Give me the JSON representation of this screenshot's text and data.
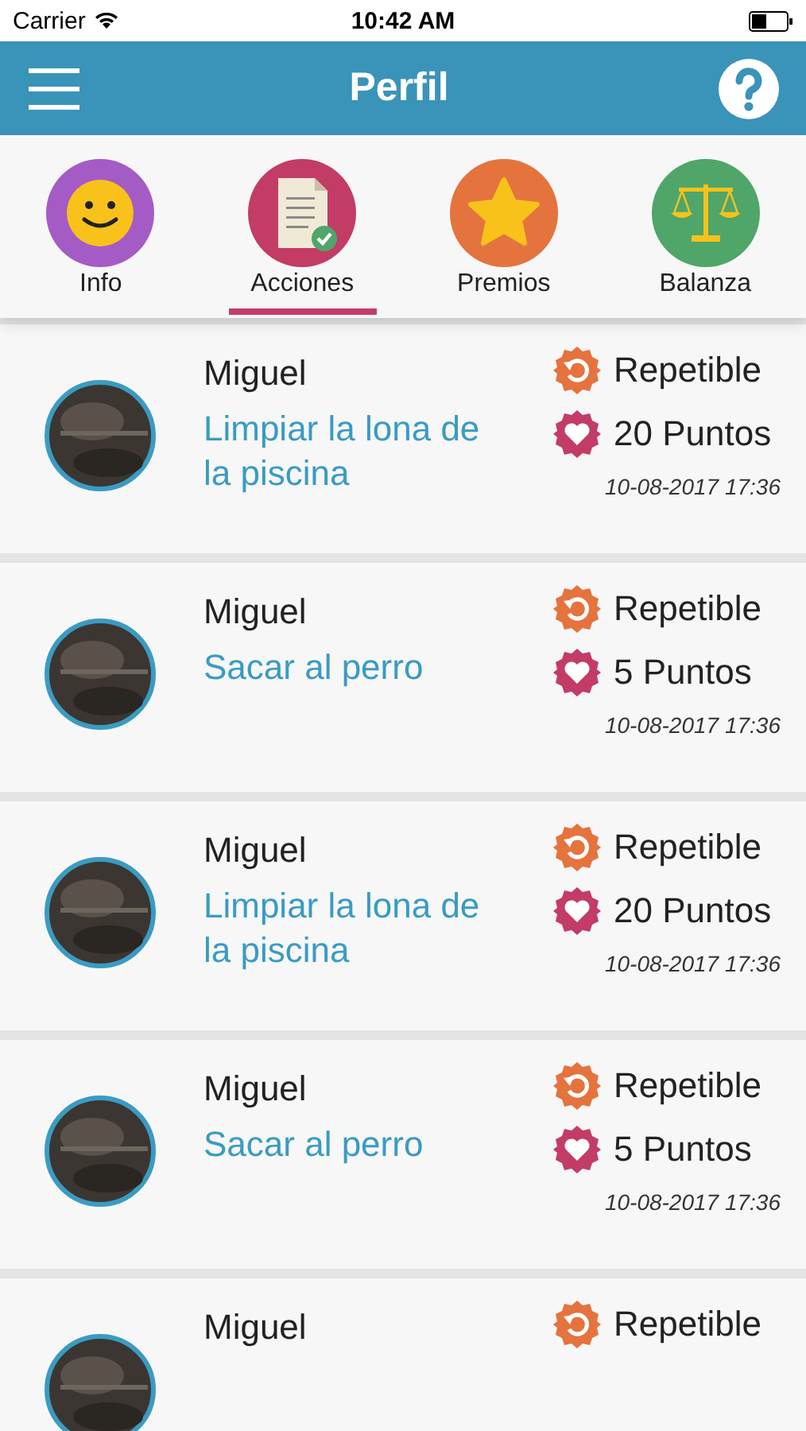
{
  "status_bar": {
    "carrier": "Carrier",
    "time": "10:42 AM"
  },
  "header": {
    "title": "Perfil"
  },
  "tabs": [
    {
      "label": "Info",
      "kind": "smiley",
      "color": "#a45bc6",
      "selected": false
    },
    {
      "label": "Acciones",
      "kind": "document",
      "color": "#c23c66",
      "selected": true
    },
    {
      "label": "Premios",
      "kind": "star",
      "color": "#e5733d",
      "selected": false
    },
    {
      "label": "Balanza",
      "kind": "scale",
      "color": "#4fa668",
      "selected": false
    }
  ],
  "actions": [
    {
      "name": "Miguel",
      "task": "Limpiar la lona de la piscina",
      "repeat": "Repetible",
      "points": "20 Puntos",
      "date": "10-08-2017 17:36"
    },
    {
      "name": "Miguel",
      "task": "Sacar al perro",
      "repeat": "Repetible",
      "points": "5 Puntos",
      "date": "10-08-2017 17:36"
    },
    {
      "name": "Miguel",
      "task": "Limpiar la lona de la piscina",
      "repeat": "Repetible",
      "points": "20 Puntos",
      "date": "10-08-2017 17:36"
    },
    {
      "name": "Miguel",
      "task": "Sacar al perro",
      "repeat": "Repetible",
      "points": "5 Puntos",
      "date": "10-08-2017 17:36"
    },
    {
      "name": "Miguel",
      "repeat": "Repetible"
    }
  ]
}
